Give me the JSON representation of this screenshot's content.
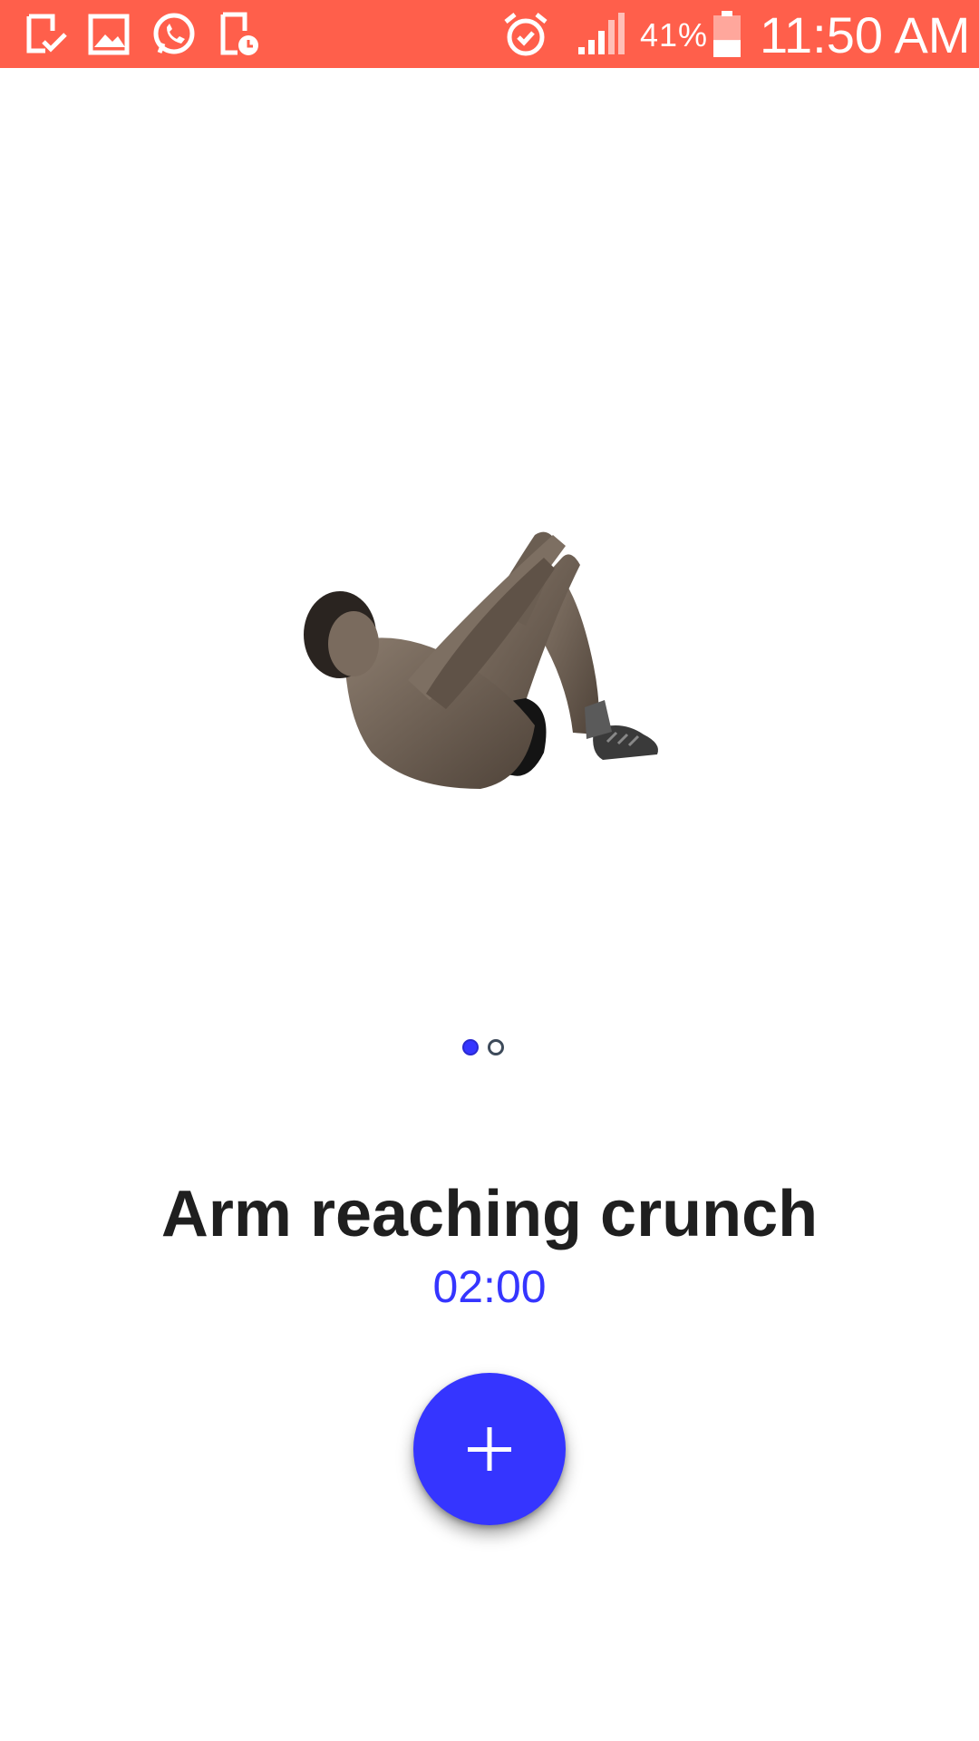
{
  "status_bar": {
    "background": "#ff5f4b",
    "left_icons": [
      "download-done-icon",
      "gallery-icon",
      "whatsapp-icon",
      "phone-schedule-icon"
    ],
    "right_icons": [
      "alarm-icon",
      "signal-icon",
      "battery-icon"
    ],
    "battery_percent": "41%",
    "battery_level": 0.41,
    "time": "11:50 AM"
  },
  "exercise": {
    "image_icon": "arm-reaching-crunch-illustration",
    "name": "Arm reaching crunch",
    "duration": "02:00"
  },
  "pager": {
    "count": 2,
    "active_index": 0,
    "active_color": "#3535ff"
  },
  "fab": {
    "icon": "plus-icon",
    "color": "#3535ff"
  }
}
